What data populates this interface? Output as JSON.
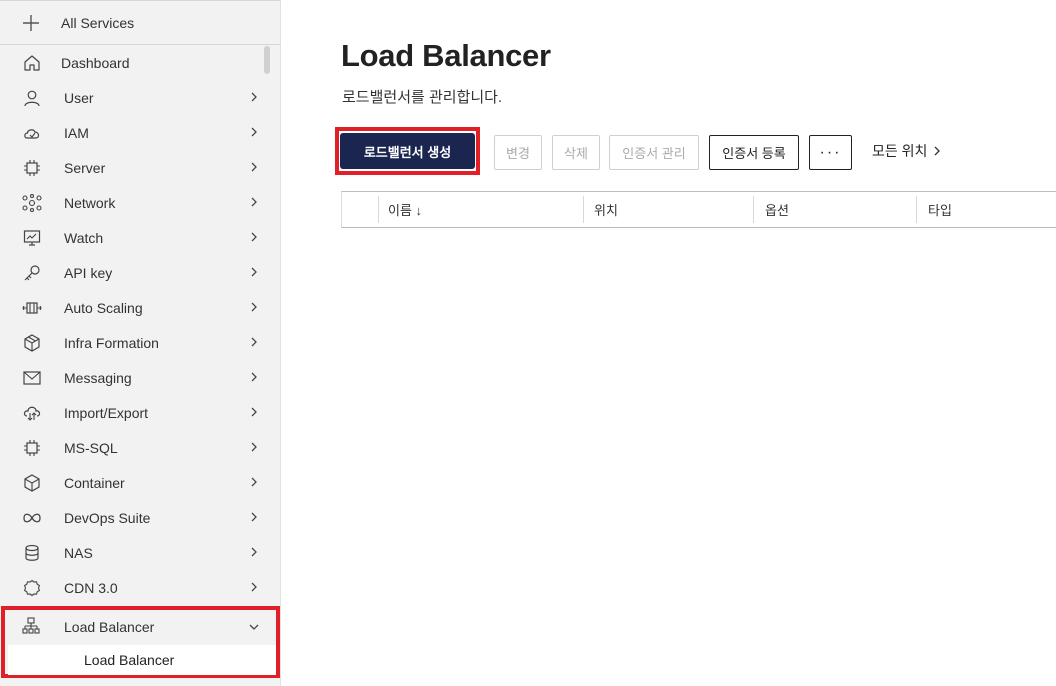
{
  "sidebar": {
    "all_services": "All Services",
    "items": [
      {
        "label": "Dashboard",
        "icon": "home-icon"
      },
      {
        "label": "User",
        "icon": "user-icon"
      },
      {
        "label": "IAM",
        "icon": "cloud-shield-icon"
      },
      {
        "label": "Server",
        "icon": "chip-icon"
      },
      {
        "label": "Network",
        "icon": "network-icon"
      },
      {
        "label": "Watch",
        "icon": "monitor-chart-icon"
      },
      {
        "label": "API key",
        "icon": "key-icon"
      },
      {
        "label": "Auto Scaling",
        "icon": "auto-scaling-icon"
      },
      {
        "label": "Infra Formation",
        "icon": "cube-stack-icon"
      },
      {
        "label": "Messaging",
        "icon": "envelope-icon"
      },
      {
        "label": "Import/Export",
        "icon": "cloud-transfer-icon"
      },
      {
        "label": "MS-SQL",
        "icon": "chip-icon"
      },
      {
        "label": "Container",
        "icon": "box-icon"
      },
      {
        "label": "DevOps Suite",
        "icon": "infinity-icon"
      },
      {
        "label": "NAS",
        "icon": "database-icon"
      },
      {
        "label": "CDN 3.0",
        "icon": "gear-cloud-icon"
      },
      {
        "label": "Load Balancer",
        "icon": "load-balancer-icon"
      }
    ],
    "expanded_sub_item": "Load Balancer"
  },
  "main": {
    "title": "Load Balancer",
    "subtitle": "로드밸런서를 관리합니다.",
    "toolbar": {
      "create": "로드밸런서 생성",
      "edit": "변경",
      "delete": "삭제",
      "cert_manage": "인증서 관리",
      "cert_register": "인증서 등록",
      "more": "···",
      "all_locations": "모든 위치"
    },
    "table": {
      "columns": [
        "이름 ↓",
        "위치",
        "옵션",
        "타입"
      ]
    }
  },
  "colors": {
    "primary_button": "#1a2650",
    "highlight_border": "#e01f26",
    "sidebar_bg": "#f2f2f2"
  }
}
